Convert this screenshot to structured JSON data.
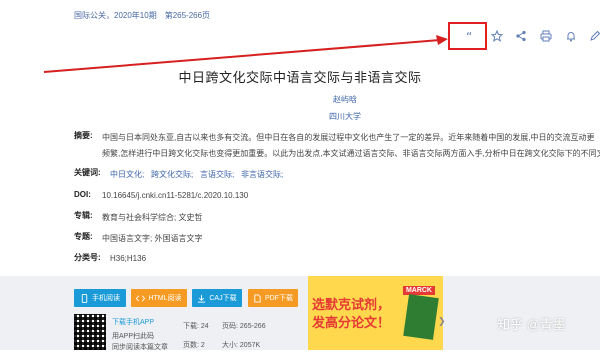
{
  "header": {
    "source": "国际公关，2020年10期　第265-266页"
  },
  "article": {
    "title": "中日跨文化交际中语言交际与非语言交际",
    "author": "赵屿晗",
    "institution": "四川大学",
    "abstract_label": "摘要:",
    "abstract_line1": "中国与日本同处东亚,自古以来也多有交流。但中日在各自的发展过程中文化也产生了一定的差异。近年来随着中国的发展,中日的交流互动更",
    "abstract_line2": "频繁,怎样进行中日跨文化交际也变得更加重要。以此为出发点,本文试通过语言交际、非语言交际两方面入手,分析中日在跨文化交际下的不同文化。",
    "keywords_label": "关键词:",
    "keywords": [
      "中日文化;",
      "跨文化交际;",
      "言语交际;",
      "非言语交际;"
    ],
    "doi_label": "DOI:",
    "doi": "10.16645/j.cnki.cn11-5281/c.2020.10.130",
    "series_label": "专辑:",
    "series": "教育与社会科学综合; 文史哲",
    "topic_label": "专题:",
    "topic": "中国语言文字; 外国语言文字",
    "class_label": "分类号:",
    "class": "H36;H136"
  },
  "buttons": [
    {
      "label": "手机阅读",
      "icon": "phone-icon",
      "color": "#1a9bd8"
    },
    {
      "label": "HTML阅读",
      "icon": "code-icon",
      "color": "#f59a23"
    },
    {
      "label": "CAJ下载",
      "icon": "download-icon",
      "color": "#1a9bd8"
    },
    {
      "label": "PDF下载",
      "icon": "pdf-icon",
      "color": "#f59a23"
    }
  ],
  "app": {
    "download_label": "下载手机APP",
    "scan_text": "用APP扫此码",
    "sync_text": "同步阅读本篇文章"
  },
  "stats": {
    "downloads_label": "下载:",
    "downloads": "24",
    "pages_label": "页码:",
    "pages": "265-266",
    "page_count_label": "页数:",
    "page_count": "2",
    "size_label": "大小:",
    "size": "2057K"
  },
  "ad": {
    "brand": "MARCK",
    "line1": "选默克试剂，",
    "line2": "发高分论文！",
    "next": "❯"
  },
  "watermark": "知乎 @青墨",
  "colors": {
    "accent": "#3b63a8",
    "highlight": "#e02020"
  }
}
